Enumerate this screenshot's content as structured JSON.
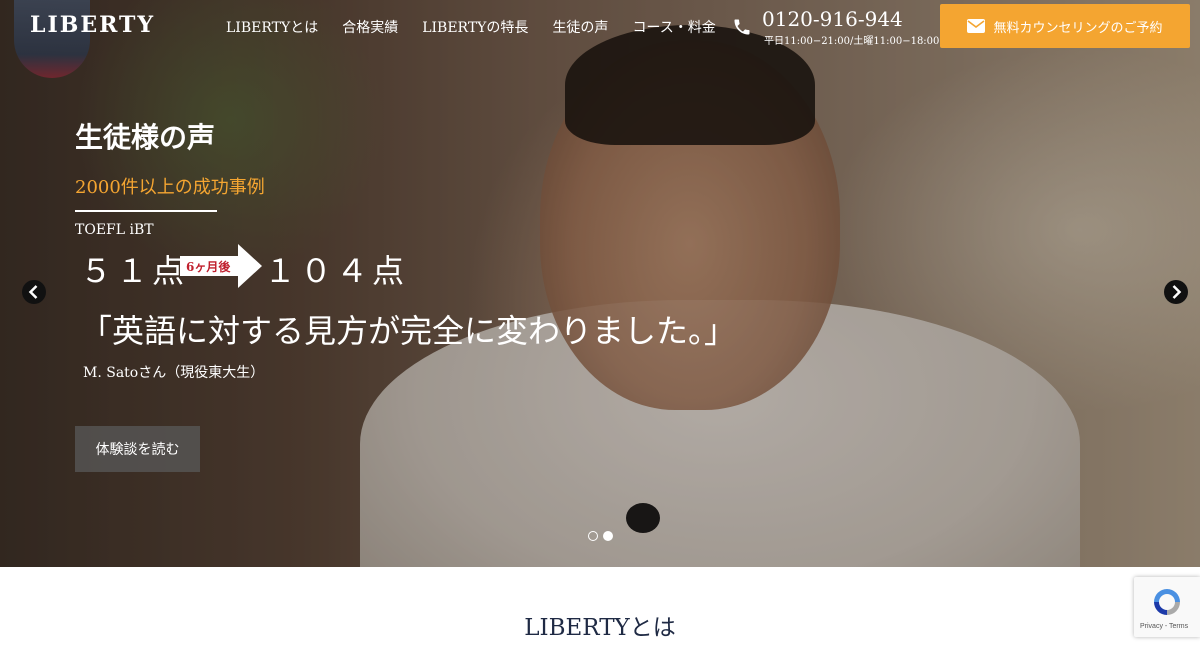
{
  "brand": {
    "logo_text": "LIBERTY"
  },
  "nav": {
    "items": [
      "LIBERTYとは",
      "合格実績",
      "LIBERTYの特長",
      "生徒の声",
      "コース・料金"
    ]
  },
  "contact": {
    "phone": "0120-916-944",
    "hours": "平日11:00−21:00/土曜11:00−18:00",
    "cta_label": "無料カウンセリングのご予約"
  },
  "hero": {
    "title": "生徒様の声",
    "subtitle": "2000件以上の成功事例",
    "test_name": "TOEFL iBT",
    "score_before": "５１点",
    "duration": "6ヶ月後",
    "score_after": "１０４点",
    "quote": "「英語に対する見方が完全に変わりました。」",
    "person": "M. Satoさん（現役東大生）",
    "button_label": "体験談を読む",
    "slide_count": 2,
    "active_slide": 2
  },
  "section": {
    "title": "LIBERTYとは"
  },
  "recaptcha": {
    "footer": "Privacy - Terms"
  },
  "colors": {
    "accent": "#f4a531",
    "navy": "#1f2a44",
    "badge_red": "#c0202e"
  },
  "icons": [
    "phone-icon",
    "envelope-icon",
    "chevron-left-icon",
    "chevron-right-icon",
    "recaptcha-icon"
  ]
}
